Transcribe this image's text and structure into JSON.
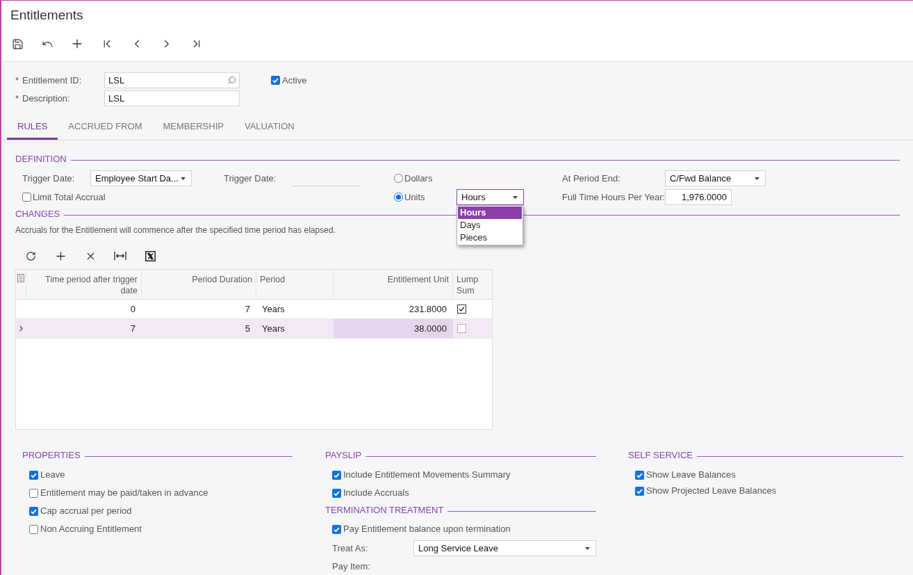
{
  "title": "Entitlements",
  "form": {
    "fields": [
      {
        "kind": "lookup",
        "mark": "*",
        "label": "Entitlement ID:",
        "value": "LSL"
      },
      {
        "kind": "text",
        "mark": "*",
        "label": "Description:",
        "value": "LSL"
      }
    ],
    "active": {
      "label": "Active",
      "checked": true
    }
  },
  "tabs": [
    {
      "label": "RULES",
      "selected": true
    },
    {
      "label": "ACCRUED FROM",
      "selected": false
    },
    {
      "label": "MEMBERSHIP",
      "selected": false
    },
    {
      "label": "VALUATION",
      "selected": false
    }
  ],
  "definition": {
    "title": "DEFINITION",
    "trigger_date": {
      "label": "Trigger Date:",
      "value": "Employee Start Da..."
    },
    "trigger_date_field": {
      "label": "Trigger Date:"
    },
    "limit_total_accrual": {
      "label": "Limit Total Accrual",
      "checked": false
    },
    "basis": [
      {
        "label": "Dollars",
        "selected": false
      },
      {
        "label": "Units",
        "selected": true
      }
    ],
    "unit": {
      "value": "Hours",
      "expanded": true,
      "options": [
        {
          "label": "Hours",
          "selected": true
        },
        {
          "label": "Days",
          "selected": false
        },
        {
          "label": "Pieces",
          "selected": false
        }
      ]
    },
    "at_period_end": {
      "label": "At Period End:",
      "value": "C/Fwd Balance"
    },
    "full_time_hours": {
      "label": "Full Time Hours Per Year:",
      "value": "1,976.0000"
    }
  },
  "changes": {
    "title": "CHANGES",
    "note": "Accruals for the Entitlement will commence after the specified time period has elapsed.",
    "table": {
      "columns": [
        {
          "label": "Time period after trigger date",
          "kind": "number"
        },
        {
          "label": "Period Duration",
          "kind": "number"
        },
        {
          "label": "Period",
          "kind": "text"
        },
        {
          "label": "Entitlement Unit",
          "kind": "number"
        },
        {
          "label": "Lump Sum",
          "kind": "check"
        }
      ],
      "rows": [
        {
          "selected": false,
          "lump_sum": true,
          "cells": [
            {
              "value": "0",
              "focused": false
            },
            {
              "value": "7",
              "focused": false
            },
            {
              "value": "Years",
              "focused": false
            },
            {
              "value": "231.8000",
              "focused": false
            }
          ]
        },
        {
          "selected": true,
          "lump_sum": false,
          "cells": [
            {
              "value": "7",
              "focused": false
            },
            {
              "value": "5",
              "focused": false
            },
            {
              "value": "Years",
              "focused": false
            },
            {
              "value": "38.0000",
              "focused": true
            }
          ]
        }
      ]
    }
  },
  "properties": {
    "title": "PROPERTIES",
    "items": [
      {
        "label": "Leave",
        "checked": true
      },
      {
        "label": "Entitlement may be paid/taken in advance",
        "checked": false
      },
      {
        "label": "Cap accrual per period",
        "checked": true
      },
      {
        "label": "Non Accruing Entitlement",
        "checked": false
      }
    ]
  },
  "payslip": {
    "title": "PAYSLIP",
    "items": [
      {
        "label": "Include Entitlement Movements Summary",
        "checked": true
      },
      {
        "label": "Include Accruals",
        "checked": true
      }
    ]
  },
  "termination_treatment": {
    "title": "TERMINATION TREATMENT",
    "pay_balance": {
      "label": "Pay Entitlement balance upon termination",
      "checked": true
    },
    "treat_as": {
      "label": "Treat As:",
      "value": "Long Service Leave"
    },
    "pay_item": {
      "label": "Pay Item:"
    }
  },
  "self_service": {
    "title": "SELF SERVICE",
    "items": [
      {
        "label": "Show Leave Balances",
        "checked": true
      },
      {
        "label": "Show Projected Leave Balances",
        "checked": true
      }
    ]
  }
}
